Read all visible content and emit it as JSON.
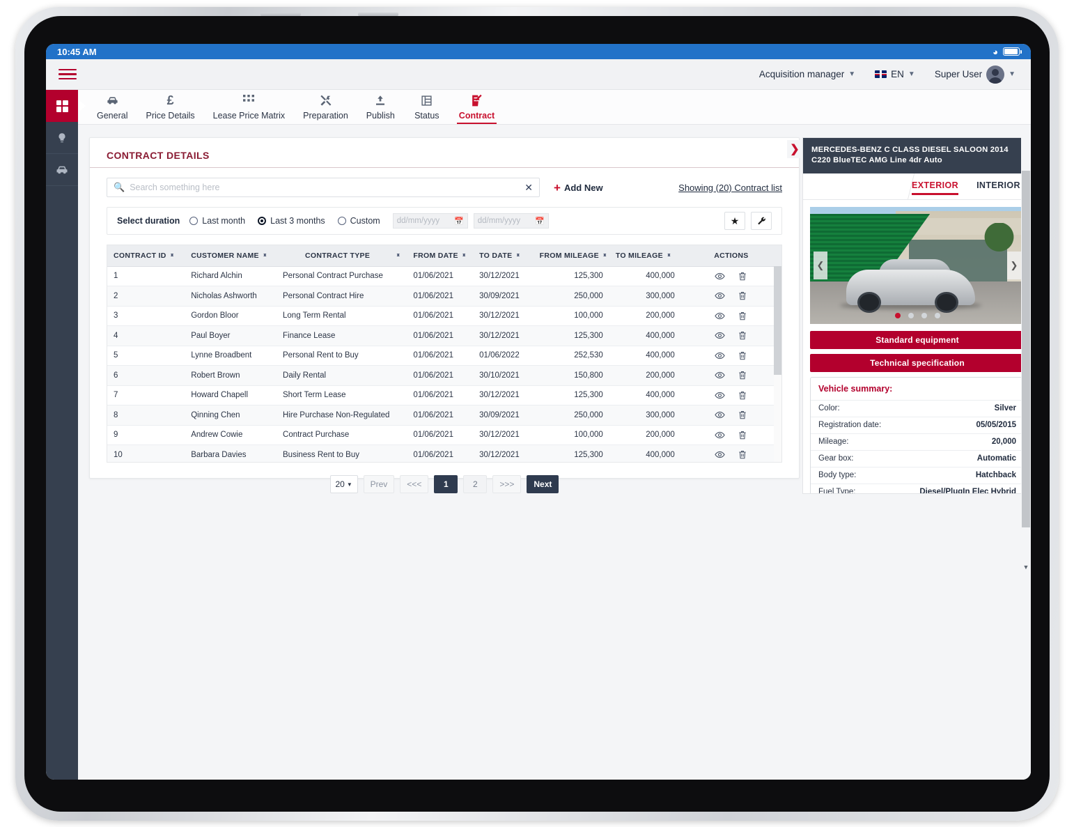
{
  "status_bar": {
    "time": "10:45 AM",
    "wifi_icon": "wifi-icon",
    "battery_icon": "battery-icon"
  },
  "header": {
    "menu_icon": "hamburger-menu-icon",
    "role": "Acquisition manager",
    "language": "EN",
    "language_flag": "uk-flag-icon",
    "user": "Super User",
    "avatar_icon": "user-avatar-icon"
  },
  "rail": [
    {
      "name": "dashboard",
      "icon": "dashboard-tiles-icon",
      "active": true
    },
    {
      "name": "insights",
      "icon": "lightbulb-person-icon",
      "active": false
    },
    {
      "name": "vehicles",
      "icon": "car-icon",
      "active": false
    }
  ],
  "tabs": [
    {
      "label": "General",
      "icon": "car-icon",
      "active": false
    },
    {
      "label": "Price Details",
      "icon": "pound-sterling-icon",
      "active": false
    },
    {
      "label": "Lease Price Matrix",
      "icon": "grid-dots-icon",
      "active": false
    },
    {
      "label": "Preparation",
      "icon": "tools-icon",
      "active": false
    },
    {
      "label": "Publish",
      "icon": "upload-icon",
      "active": false
    },
    {
      "label": "Status",
      "icon": "list-table-icon",
      "active": false
    },
    {
      "label": "Contract",
      "icon": "contract-document-icon",
      "active": true
    }
  ],
  "card": {
    "title": "CONTRACT DETAILS",
    "search": {
      "placeholder": "Search something here",
      "value": "",
      "icon": "search-icon",
      "clear_icon": "close-icon"
    },
    "add_new": "Add New",
    "showing": "Showing (20) Contract list",
    "duration": {
      "label": "Select duration",
      "options": [
        {
          "label": "Last month",
          "selected": false
        },
        {
          "label": "Last 3 months",
          "selected": true
        },
        {
          "label": "Custom",
          "selected": false
        }
      ],
      "date_from_placeholder": "dd/mm/yyyy",
      "date_to_placeholder": "dd/mm/yyyy",
      "calendar_icon": "calendar-icon",
      "favorite_icon": "star-icon",
      "settings_icon": "wrench-icon"
    }
  },
  "table": {
    "columns": [
      {
        "label": "CONTRACT ID",
        "sortable": true,
        "align": "left"
      },
      {
        "label": "CUSTOMER NAME",
        "sortable": true,
        "align": "left"
      },
      {
        "label": "CONTRACT TYPE",
        "sortable": true,
        "align": "left"
      },
      {
        "label": "FROM DATE",
        "sortable": true,
        "align": "left"
      },
      {
        "label": "TO DATE",
        "sortable": true,
        "align": "left"
      },
      {
        "label": "FROM MILEAGE",
        "sortable": true,
        "align": "right"
      },
      {
        "label": "TO MILEAGE",
        "sortable": true,
        "align": "right"
      },
      {
        "label": "ACTIONS",
        "sortable": false,
        "align": "center"
      }
    ],
    "view_icon": "eye-icon",
    "delete_icon": "trash-icon",
    "rows": [
      {
        "id": "1",
        "customer": "Richard Alchin",
        "type": "Personal Contract Purchase",
        "from": "01/06/2021",
        "to": "30/12/2021",
        "from_mileage": "125,300",
        "to_mileage": "400,000"
      },
      {
        "id": "2",
        "customer": "Nicholas Ashworth",
        "type": "Personal Contract Hire",
        "from": "01/06/2021",
        "to": "30/09/2021",
        "from_mileage": "250,000",
        "to_mileage": "300,000"
      },
      {
        "id": "3",
        "customer": "Gordon Bloor",
        "type": "Long Term Rental",
        "from": "01/06/2021",
        "to": "30/12/2021",
        "from_mileage": "100,000",
        "to_mileage": "200,000"
      },
      {
        "id": "4",
        "customer": "Paul Boyer",
        "type": "Finance Lease",
        "from": "01/06/2021",
        "to": "30/12/2021",
        "from_mileage": "125,300",
        "to_mileage": "400,000"
      },
      {
        "id": "5",
        "customer": "Lynne Broadbent",
        "type": "Personal Rent to Buy",
        "from": "01/06/2021",
        "to": "01/06/2022",
        "from_mileage": "252,530",
        "to_mileage": "400,000"
      },
      {
        "id": "6",
        "customer": "Robert Brown",
        "type": "Daily Rental",
        "from": "01/06/2021",
        "to": "30/10/2021",
        "from_mileage": "150,800",
        "to_mileage": "200,000"
      },
      {
        "id": "7",
        "customer": "Howard Chapell",
        "type": "Short Term Lease",
        "from": "01/06/2021",
        "to": "30/12/2021",
        "from_mileage": "125,300",
        "to_mileage": "400,000"
      },
      {
        "id": "8",
        "customer": "Qinning Chen",
        "type": "Hire Purchase Non-Regulated",
        "from": "01/06/2021",
        "to": "30/09/2021",
        "from_mileage": "250,000",
        "to_mileage": "300,000"
      },
      {
        "id": "9",
        "customer": "Andrew Cowie",
        "type": "Contract Purchase",
        "from": "01/06/2021",
        "to": "30/12/2021",
        "from_mileage": "100,000",
        "to_mileage": "200,000"
      },
      {
        "id": "10",
        "customer": "Barbara Davies",
        "type": "Business Rent to Buy",
        "from": "01/06/2021",
        "to": "30/12/2021",
        "from_mileage": "125,300",
        "to_mileage": "400,000"
      }
    ]
  },
  "pagination": {
    "page_size": "20",
    "prev": "Prev",
    "first": "<<<",
    "last": ">>>",
    "pages": [
      "1",
      "2"
    ],
    "current_page": "1",
    "next": "Next"
  },
  "vehicle_panel": {
    "collapse_icon": "chevron-right-icon",
    "title": "MERCEDES-BENZ C CLASS DIESEL SALOON 2014 C220 BlueTEC AMG Line 4dr Auto",
    "tabs": [
      {
        "label": "EXTERIOR",
        "active": true
      },
      {
        "label": "INTERIOR",
        "active": false
      }
    ],
    "carousel": {
      "prev_icon": "chevron-left-icon",
      "next_icon": "chevron-right-icon",
      "dots": 4,
      "active_dot": 1
    },
    "buttons": [
      {
        "label": "Standard equipment"
      },
      {
        "label": "Technical specification"
      }
    ],
    "summary": {
      "title": "Vehicle summary:",
      "rows": [
        {
          "key": "Color:",
          "value": "Silver"
        },
        {
          "key": "Registration date:",
          "value": "05/05/2015"
        },
        {
          "key": "Mileage:",
          "value": "20,000"
        },
        {
          "key": "Gear box:",
          "value": "Automatic"
        },
        {
          "key": "Body type:",
          "value": "Hatchback"
        },
        {
          "key": "Fuel Type:",
          "value": "Diesel/PlugIn Elec Hybrid"
        }
      ]
    }
  },
  "colors": {
    "brand_red": "#b3002d",
    "accent_red": "#c8102e",
    "dark_navy": "#36404f",
    "status_blue": "#2272c8"
  }
}
